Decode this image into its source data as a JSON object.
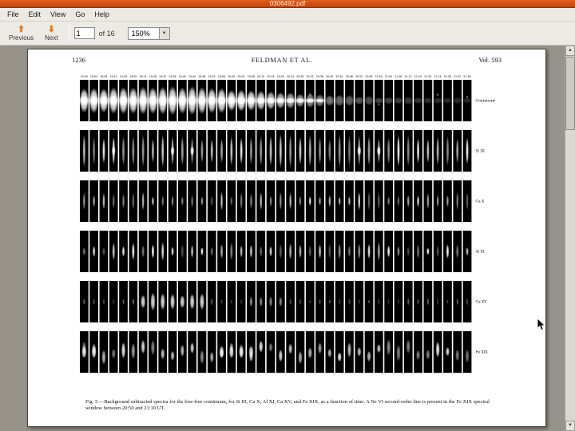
{
  "window": {
    "title": "0306492.pdf"
  },
  "menu": {
    "items": [
      "File",
      "Edit",
      "View",
      "Go",
      "Help"
    ]
  },
  "toolbar": {
    "previous": "Previous",
    "next": "Next",
    "page_value": "1",
    "of_pages": "of 16",
    "zoom": "150%"
  },
  "page": {
    "header_left": "1236",
    "header_center": "FELDMAN ET AL.",
    "header_right": "Vol. 593",
    "caption": "Fig. 5.—Background subtracted spectra for the free-free continuum, for Si III, Ca X, Al XI, Ca XV, and Fe XIX, as a function of time. A Ne VI second-order line is present in the Fe XIX spectral window between 20:50 and 21:10 UT."
  },
  "figure": {
    "time_labels": [
      "19:00",
      "19:04",
      "19:08",
      "19:12",
      "19:16",
      "19:20",
      "19:24",
      "19:28",
      "19:32",
      "19:36",
      "19:40",
      "19:44",
      "19:48",
      "19:52",
      "19:56",
      "20:00",
      "20:04",
      "20:08",
      "20:12",
      "20:16",
      "20:20",
      "20:24",
      "20:28",
      "20:32",
      "20:36",
      "20:40",
      "20:44",
      "20:48",
      "20:52",
      "20:56",
      "21:00",
      "21:04",
      "21:08",
      "21:12",
      "21:16",
      "21:20",
      "21:24",
      "21:28",
      "21:32",
      "21:36"
    ],
    "panels": [
      {
        "label": "Continuum",
        "style": "continuum"
      },
      {
        "label": "Si III",
        "style": "tall"
      },
      {
        "label": "Ca X",
        "style": "dot"
      },
      {
        "label": "Al XI",
        "style": "dot2"
      },
      {
        "label": "Ca XV",
        "style": "cluster"
      },
      {
        "label": "Fe XIX",
        "style": "wide"
      }
    ]
  }
}
